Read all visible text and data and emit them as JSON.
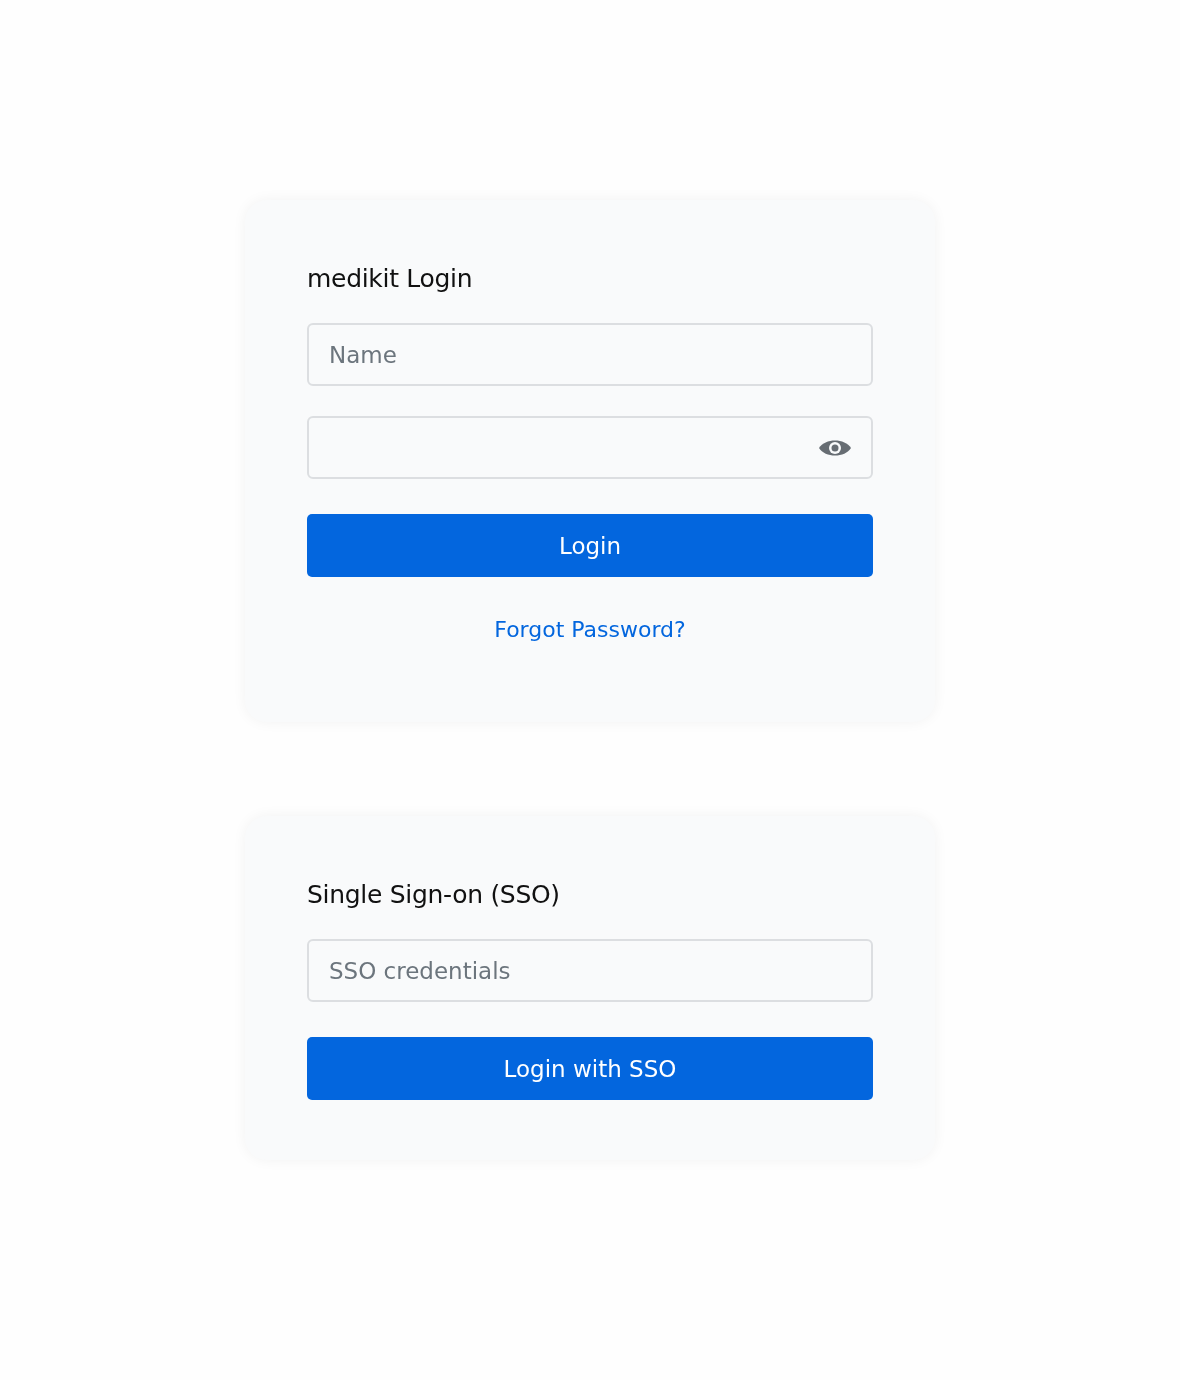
{
  "cards": [
    {
      "title": "medikit Login",
      "items": [
        {
          "kind": "text-field",
          "placeholder": "Name"
        },
        {
          "kind": "password-field"
        },
        {
          "kind": "button",
          "label": "Login"
        },
        {
          "kind": "link",
          "label": "Forgot Password?"
        }
      ]
    },
    {
      "title": "Single Sign-on (SSO)",
      "items": [
        {
          "kind": "text-field",
          "placeholder": "SSO credentials"
        },
        {
          "kind": "button",
          "label": "Login with SSO"
        }
      ]
    }
  ]
}
